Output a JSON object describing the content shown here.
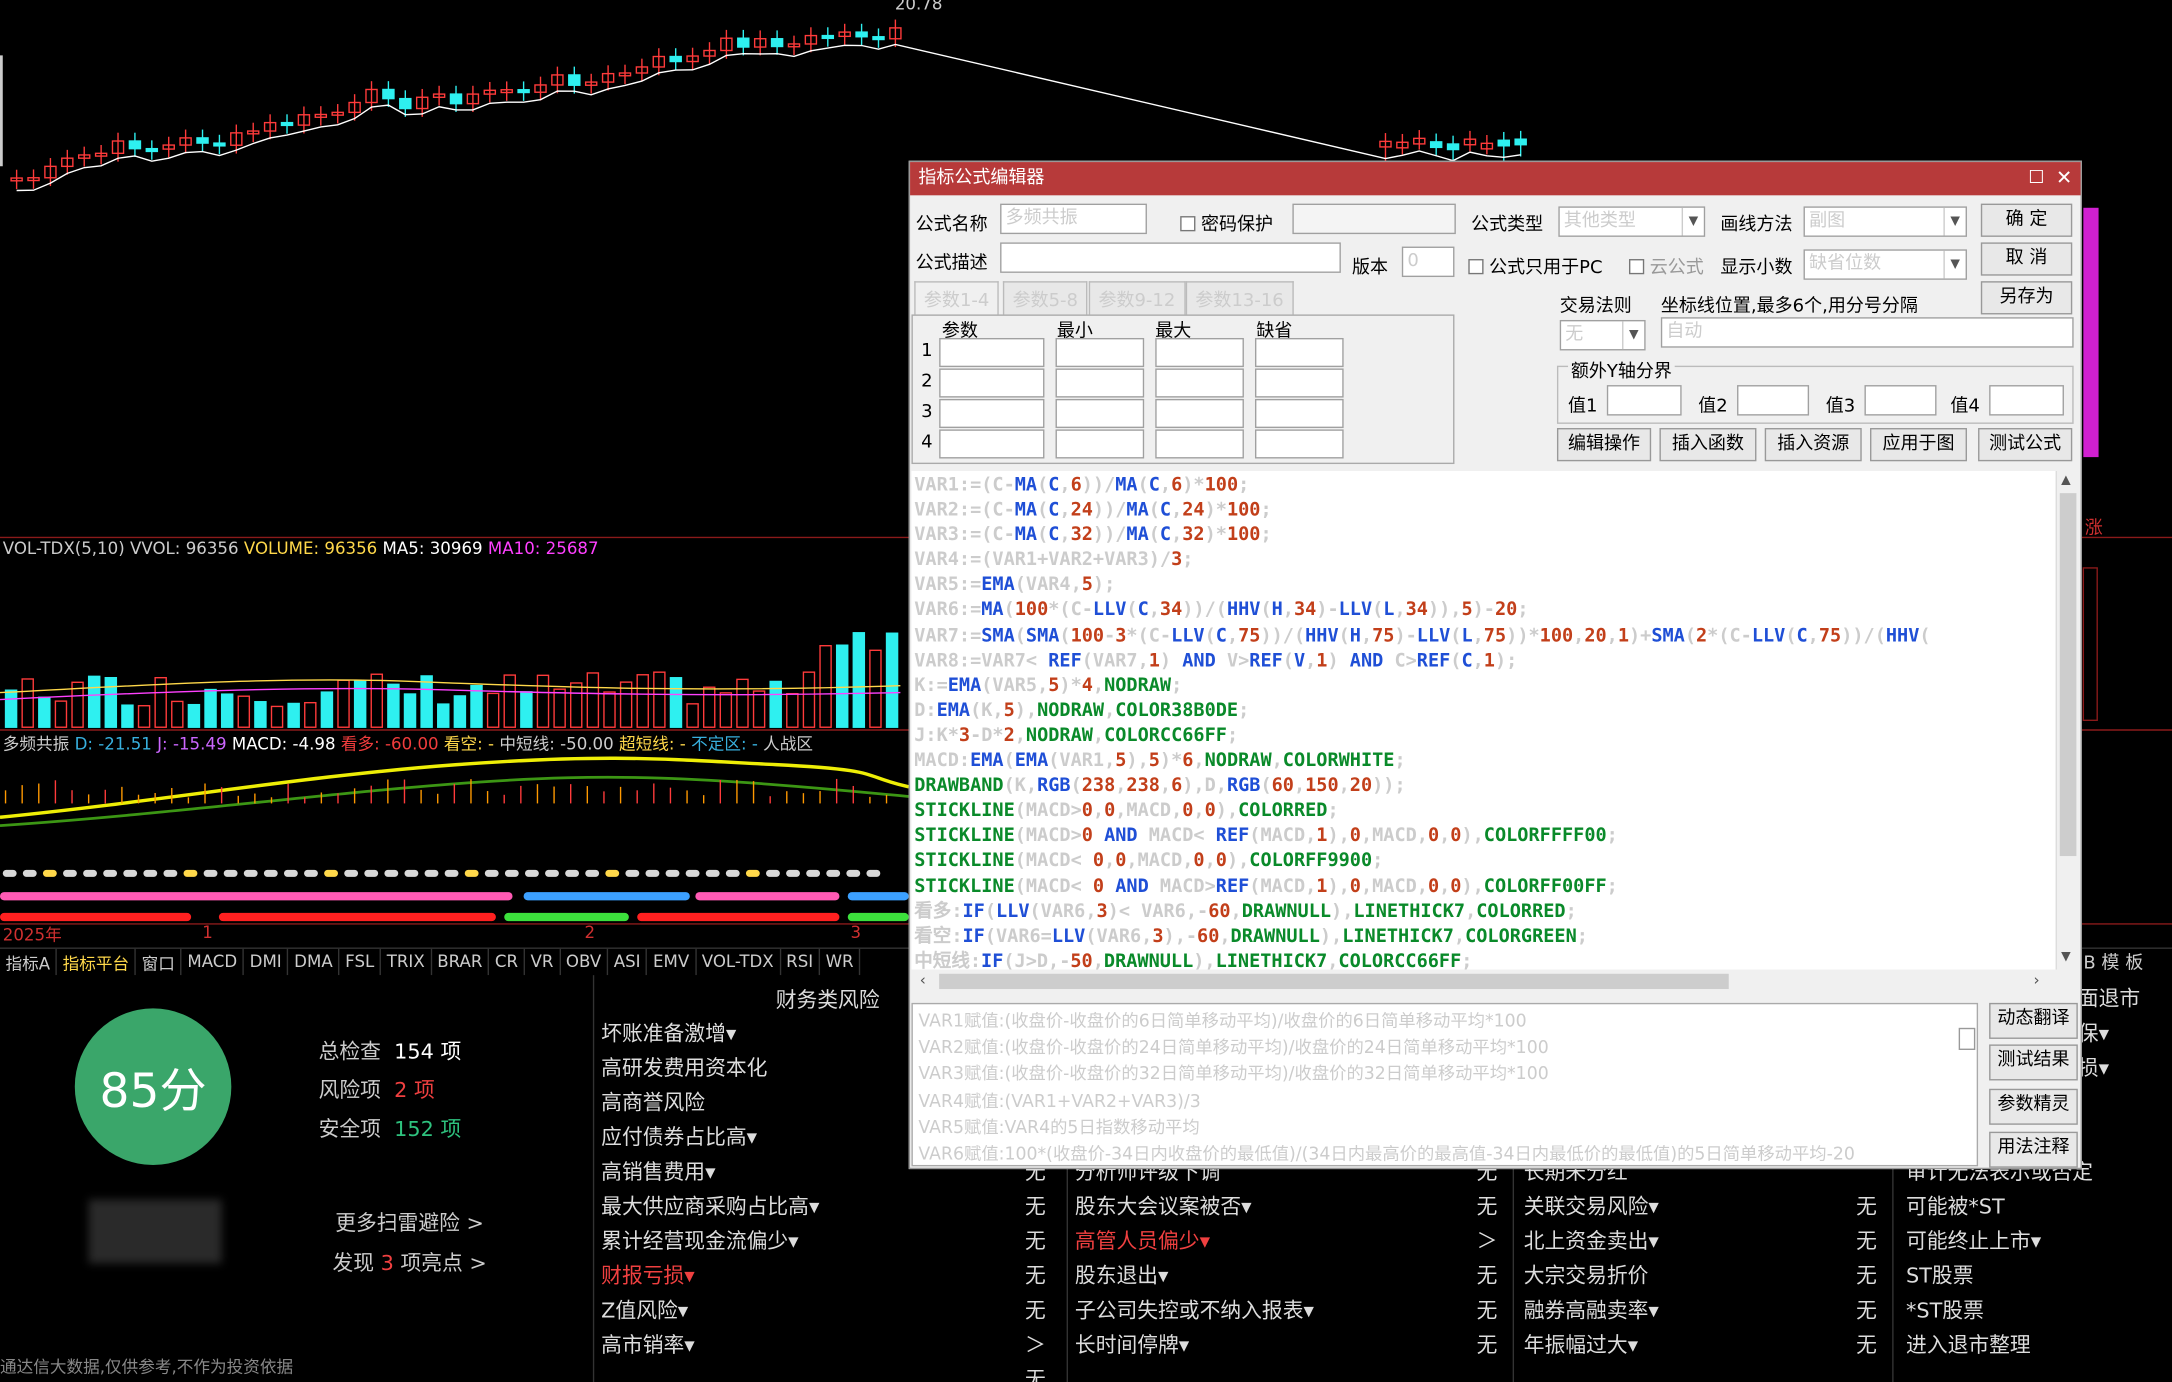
{
  "chart": {
    "price_label": "20.78",
    "vol_legend": {
      "name": "VOL-TDX(5,10)",
      "vvol": "VVOL: 96356",
      "volume": "VOLUME: 96356",
      "ma5": "MA5: 30969",
      "ma10": "MA10: 25687"
    },
    "ind_legend": {
      "name": "多频共振",
      "d": "D: -21.51",
      "j": "J: -15.49",
      "macd": "MACD: -4.98",
      "kanduo": "看多: -60.00",
      "kankong": "看空: -",
      "zhongduan": "中短线: -50.00",
      "chaoduan": "超短线: -",
      "buding": "不定区: -",
      "renzhan": "人战区"
    },
    "axis_labels": [
      "2025年",
      "1",
      "2",
      "3"
    ],
    "right_clip": "涨",
    "colors": {
      "up": "#ff3b3b",
      "down": "#2ef0f0",
      "ma5": "#ffffff",
      "ma10": "#ff40ff"
    }
  },
  "bottom_tabs": [
    "指标A",
    "指标平台",
    "窗口",
    "MACD",
    "DMI",
    "DMA",
    "FSL",
    "TRIX",
    "BRAR",
    "CR",
    "VR",
    "OBV",
    "ASI",
    "EMV",
    "VOL-TDX",
    "RSI",
    "WR"
  ],
  "bottom_tabs_right": [
    "B",
    "模",
    "板"
  ],
  "risk": {
    "score": "85分",
    "total_label": "总检查",
    "total_value": "154 项",
    "risk_label": "风险项",
    "risk_value": "2 项",
    "safe_label": "安全项",
    "safe_value": "152 项",
    "more": "更多扫雷避险 >",
    "found_prefix": "发现",
    "found_num": "3",
    "found_suffix": "项亮点 >",
    "disclaimer": "通达信大数据,仅供参考,不作为投资依据",
    "section_title": "财务类风险",
    "col1": [
      "坏账准备激增▾",
      "高研发费用资本化",
      "高商誉风险",
      "应付债券占比高▾",
      "高销售费用▾",
      "最大供应商采购占比高▾",
      "累计经营现金流偏少▾",
      "财报亏损▾",
      "Z值风险▾",
      "高市销率▾"
    ],
    "col1_vals": [
      "无",
      "无",
      "无",
      "无",
      "无",
      "＞",
      "无",
      "无"
    ],
    "col2": [
      "分析师评级下调",
      "股东大会议案被否▾",
      "高管人员偏少▾",
      "股东退出▾",
      "子公司失控或不纳入报表▾",
      "长时间停牌▾"
    ],
    "col2_vals": [
      "无",
      "无",
      "＞",
      "无",
      "无",
      "无"
    ],
    "col3": [
      "长期未分红",
      "关联交易风险▾",
      "北上资金卖出▾",
      "大宗交易折价",
      "融券高融卖率▾",
      "年振幅过大▾"
    ],
    "col3_vals": [
      "无",
      "无",
      "无",
      "无",
      "无",
      "无"
    ],
    "col4": [
      "可能被*ST",
      "可能终止上市▾",
      "ST股票",
      "*ST股票",
      "进入退市整理"
    ],
    "col4_top": [
      "面退市",
      "保▾",
      "损▾",
      "审计无法表示或否定"
    ]
  },
  "dialog": {
    "title": "指标公式编辑器",
    "name_label": "公式名称",
    "name_value": "多频共振",
    "pwd_label": "密码保护",
    "type_label": "公式类型",
    "type_value": "其他类型",
    "draw_label": "画线方法",
    "draw_value": "副图",
    "ok": "确  定",
    "cancel": "取  消",
    "saveas": "另存为",
    "desc_label": "公式描述",
    "version_label": "版本",
    "version_value": "0",
    "pc_only": "公式只用于PC",
    "cloud": "云公式",
    "decimals_label": "显示小数",
    "decimals_value": "缺省位数",
    "tabs": [
      "参数1-4",
      "参数5-8",
      "参数9-12",
      "参数13-16"
    ],
    "param_headers": [
      "参数",
      "最小",
      "最大",
      "缺省"
    ],
    "param_rows": [
      "1",
      "2",
      "3",
      "4"
    ],
    "trade_label": "交易法则",
    "trade_value": "无",
    "coord_label": "坐标线位置,最多6个,用分号分隔",
    "coord_value": "自动",
    "ybound_label": "额外Y轴分界",
    "y_labels": [
      "值1",
      "值2",
      "值3",
      "值4"
    ],
    "actions": [
      "编辑操作",
      "插入函数",
      "插入资源",
      "应用于图",
      "测试公式"
    ],
    "side_buttons": [
      "动态翻译",
      "测试结果",
      "参数精灵",
      "用法注释"
    ],
    "code_lines": [
      "VAR1:=(C-MA(C,6))/MA(C,6)*100;",
      "VAR2:=(C-MA(C,24))/MA(C,24)*100;",
      "VAR3:=(C-MA(C,32))/MA(C,32)*100;",
      "VAR4:=(VAR1+VAR2+VAR3)/3;",
      "VAR5:=EMA(VAR4,5);",
      "VAR6:=MA(100*(C-LLV(C,34))/(HHV(H,34)-LLV(L,34)),5)-20;",
      "VAR7:=SMA(SMA(100-3*(C-LLV(C,75))/(HHV(H,75)-LLV(L,75))*100,20,1)+SMA(2*(C-LLV(C,75))/(HHV(",
      "VAR8:=VAR7< REF(VAR7,1) AND V>REF(V,1) AND C>REF(C,1);",
      "K:=EMA(VAR5,5)*4,NODRAW;",
      "D:EMA(K,5),NODRAW,COLOR38B0DE;",
      "J:K*3-D*2,NODRAW,COLORCC66FF;",
      "MACD:EMA(EMA(VAR1,5),5)*6,NODRAW,COLORWHITE;",
      "DRAWBAND(K,RGB(238,238,6),D,RGB(60,150,20));",
      "STICKLINE(MACD>0,0,MACD,0,0),COLORRED;",
      "STICKLINE(MACD>0 AND MACD< REF(MACD,1),0,MACD,0,0),COLORFFFF00;",
      "STICKLINE(MACD< 0,0,MACD,0,0),COLORFF9900;",
      "STICKLINE(MACD< 0 AND MACD>REF(MACD,1),0,MACD,0,0),COLORFF00FF;",
      "看多:IF(LLV(VAR6,3)< VAR6,-60,DRAWNULL),LINETHICK7,COLORRED;",
      "看空:IF(VAR6=LLV(VAR6,3),-60,DRAWNULL),LINETHICK7,COLORGREEN;",
      "中短线:IF(J>D,-50,DRAWNULL),LINETHICK7,COLORCC66FF;"
    ],
    "explain_lines": [
      "VAR1赋值:(收盘价-收盘价的6日简单移动平均)/收盘价的6日简单移动平均*100",
      "VAR2赋值:(收盘价-收盘价的24日简单移动平均)/收盘价的24日简单移动平均*100",
      "VAR3赋值:(收盘价-收盘价的32日简单移动平均)/收盘价的32日简单移动平均*100",
      "VAR4赋值:(VAR1+VAR2+VAR3)/3",
      "VAR5赋值:VAR4的5日指数移动平均",
      "VAR6赋值:100*(收盘价-34日内收盘价的最低值)/(34日内最高价的最高值-34日内最低价的最低值)的5日简单移动平均-20"
    ]
  }
}
